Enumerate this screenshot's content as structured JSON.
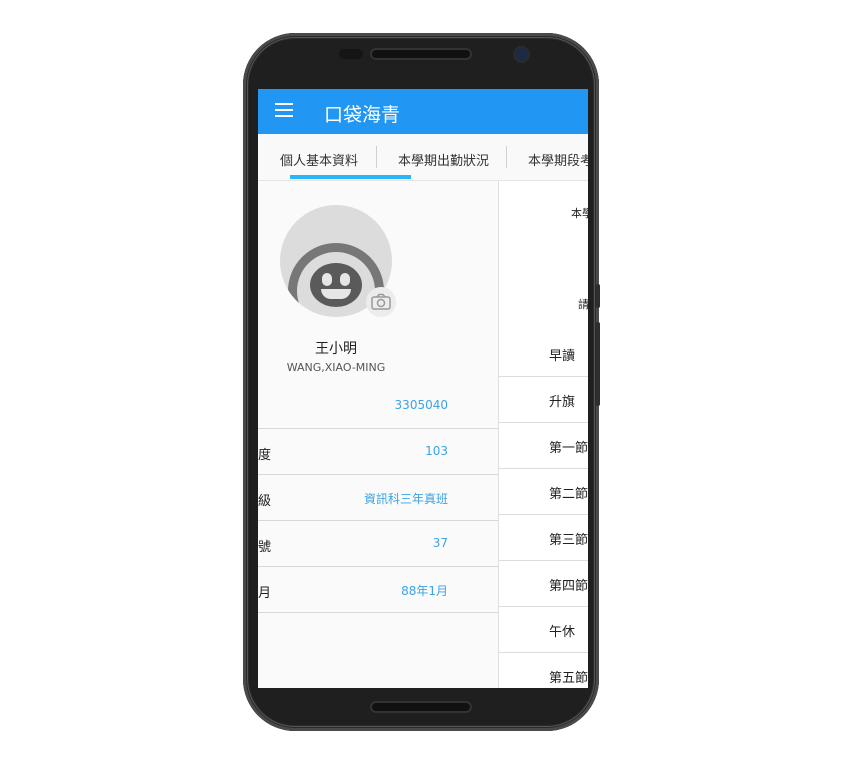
{
  "app": {
    "title": "口袋海青"
  },
  "tabs": [
    {
      "label": "個人基本資料",
      "active": true
    },
    {
      "label": "本學期出勤狀況",
      "active": false
    },
    {
      "label": "本學期段考",
      "active": false
    }
  ],
  "profile": {
    "name_zh": "王小明",
    "name_en": "WANG,XIAO-MING",
    "fields": [
      {
        "label": "",
        "value": "3305040"
      },
      {
        "label": "度",
        "value": "103"
      },
      {
        "label": "級",
        "value": "資訊科三年真班"
      },
      {
        "label": "號",
        "value": "37"
      },
      {
        "label": "月",
        "value": "88年1月"
      }
    ]
  },
  "attendance": {
    "header_top": "本學",
    "header_mid": "請",
    "periods": [
      "早讀",
      "升旗",
      "第一節",
      "第二節",
      "第三節",
      "第四節",
      "午休",
      "第五節"
    ]
  },
  "colors": {
    "appbar": "#2196f3",
    "tab_indicator": "#29b6f6",
    "value_text": "#3ba3e8"
  }
}
